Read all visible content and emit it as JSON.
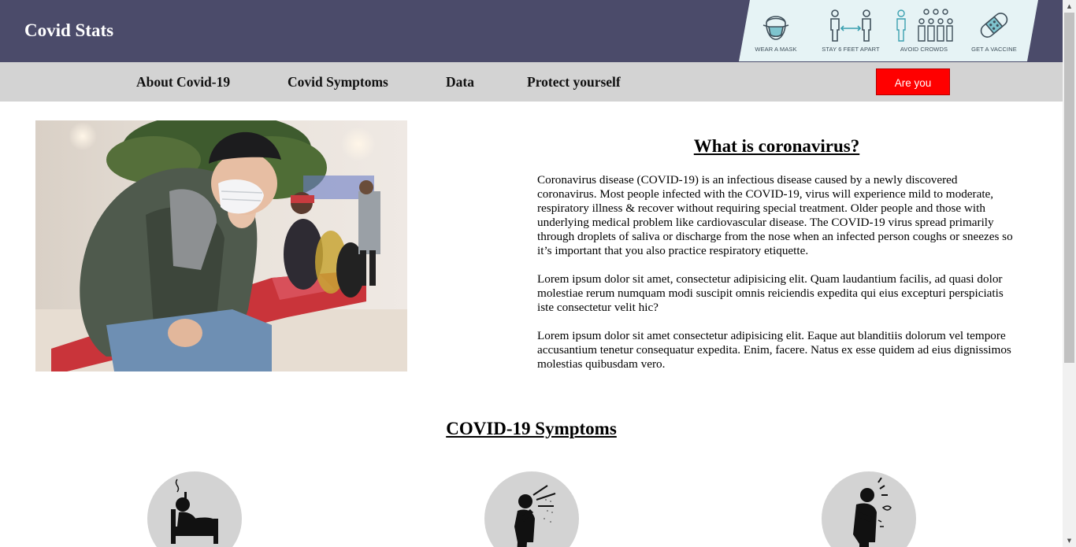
{
  "header": {
    "brand": "Covid Stats",
    "banner_items": [
      {
        "label": "Wear a mask",
        "icon": "mask-icon"
      },
      {
        "label": "Stay 6 feet apart",
        "icon": "distance-icon"
      },
      {
        "label": "Avoid crowds",
        "icon": "crowd-icon"
      },
      {
        "label": "Get a vaccine",
        "icon": "bandage-icon"
      }
    ]
  },
  "nav": {
    "links": [
      "About Covid-19",
      "Covid Symptoms",
      "Data",
      "Protect yourself"
    ],
    "cta": "Are you sick?"
  },
  "intro": {
    "title": "What is coronavirus?",
    "paragraphs": [
      "Coronavirus disease (COVID-19) is an infectious disease caused by a newly discovered coronavirus. Most people infected with the COVID-19, virus will experience mild to moderate, respiratory illness & recover without requiring special treatment. Older people and those with underlying medical problem like cardiovascular disease. The COVID-19 virus spread primarily through droplets of saliva or discharge from the nose when an infected person coughs or sneezes so it’s important that you also practice respiratory etiquette.",
      "Lorem ipsum dolor sit amet, consectetur adipisicing elit. Quam laudantium facilis, ad quasi dolor molestiae rerum numquam modi suscipit omnis reiciendis expedita qui eius excepturi perspiciatis iste consectetur velit hic?",
      "Lorem ipsum dolor sit amet consectetur adipisicing elit. Eaque aut blanditiis dolorum vel tempore accusantium tenetur consequatur expedita. Enim, facere. Natus ex esse quidem ad eius dignissimos molestias quibusdam vero."
    ]
  },
  "symptoms": {
    "title": "COVID-19 Symptoms",
    "icons": [
      "fever-in-bed-icon",
      "coughing-person-icon",
      "chest-pain-person-icon"
    ]
  },
  "colors": {
    "header_bg": "#4b4b6a",
    "nav_bg": "#d3d3d3",
    "cta_bg": "#ff0000",
    "banner_bg": "#e6f3f5"
  }
}
